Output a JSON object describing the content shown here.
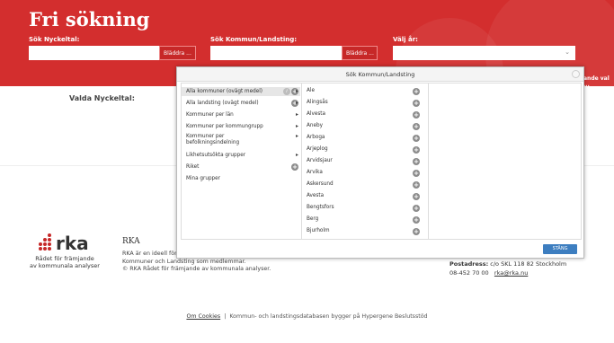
{
  "header": {
    "title": "Fri sökning",
    "nyckeltal_label": "Sök Nyckeltal:",
    "kommun_label": "Sök Kommun/Landsting:",
    "ar_label": "Välj år:",
    "browse_label": "Bläddra ...",
    "right_text": "ande val ..."
  },
  "main": {
    "valda_label": "Valda Nyckeltal:"
  },
  "modal": {
    "title": "Sök Kommun/Landsting",
    "groups": [
      {
        "label": "Alla kommuner (ovägt medel)",
        "selected": true
      },
      {
        "label": "Alla landsting (ovägt medel)"
      },
      {
        "label": "Kommuner per län"
      },
      {
        "label": "Kommuner per kommungrupp"
      },
      {
        "label": "Kommuner per befolkningsindelning"
      },
      {
        "label": "Likhetsutsökta grupper"
      },
      {
        "label": "Riket"
      },
      {
        "label": "Mina grupper"
      }
    ],
    "municipalities": [
      "Ale",
      "Alingsås",
      "Alvesta",
      "Aneby",
      "Arboga",
      "Arjeplog",
      "Arvidsjaur",
      "Arvika",
      "Askersund",
      "Avesta",
      "Bengtsfors",
      "Berg",
      "Bjurholm"
    ],
    "close_label": "STÄNG"
  },
  "footer": {
    "logo_word": "rka",
    "logo_sub_1": "Rådet för främjande",
    "logo_sub_2": "av kommunala analyser",
    "rka_title": "RKA",
    "rka_line_1": "RKA är en ideell före",
    "rka_line_2": "Kommuner och Landsting som medlemmar.",
    "rka_line_3": "© RKA Rådet för främjande av kommunala analyser.",
    "postal_label": "Postadress:",
    "postal_value": "c/o SKL 118 82 Stockholm",
    "phone": "08-452 70 00",
    "email": "rka@rka.nu",
    "cookies": "Om Cookies",
    "separator": "|",
    "credit": "Kommun- och landstingsdatabasen bygger på Hypergene Beslutsstöd"
  },
  "colors": {
    "brand_red": "#d32e2e",
    "button_blue": "#3d7ec0"
  }
}
